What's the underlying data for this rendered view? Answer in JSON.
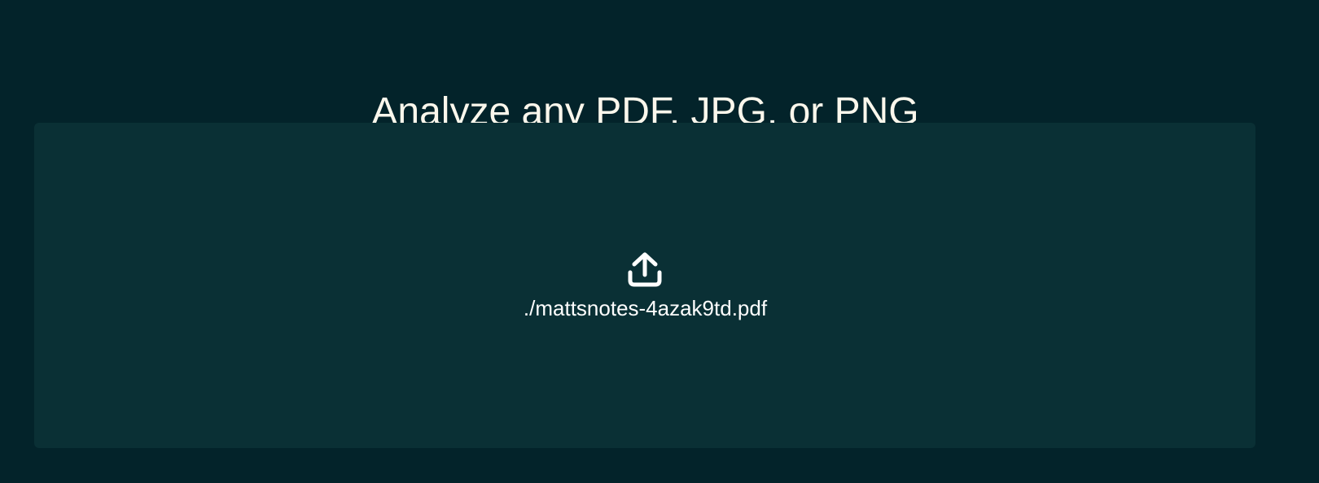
{
  "page": {
    "title": "Analyze any PDF, JPG, or PNG"
  },
  "upload": {
    "icon": "upload-icon",
    "file_name": "./mattsnotes-4azak9td.pdf"
  },
  "colors": {
    "background": "#03232a",
    "dropzone": "#0a3035",
    "text": "#fbf7ec"
  }
}
